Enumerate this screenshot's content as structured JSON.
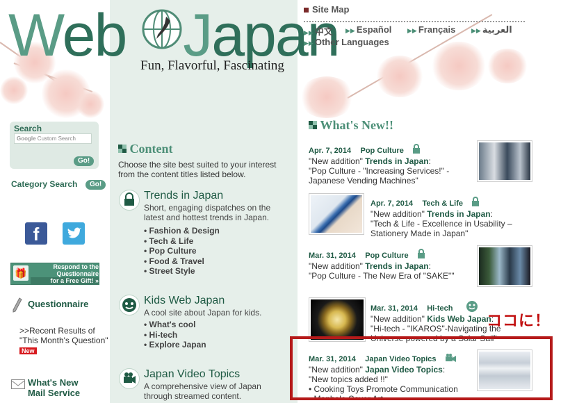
{
  "logo": {
    "first_letter": "W",
    "part1": "eb",
    "part2": "apan",
    "j": "J"
  },
  "tagline": "Fun, Flavorful, Fascinating",
  "search": {
    "label": "Search",
    "placeholder": "Custom Search",
    "google": "Google",
    "go": "Go!"
  },
  "category_search": {
    "label": "Category Search",
    "go": "Go!"
  },
  "social": {
    "facebook": "f"
  },
  "banner": {
    "line1": "Respond to the",
    "line2": "Questionnaire",
    "line3": "for a Free Gift! »"
  },
  "questionnaire": {
    "label": "Questionnaire",
    "recent": ">>Recent Results of \"This Month's Question\"",
    "new": "New"
  },
  "mail": {
    "line1": "What's New",
    "line2": "Mail Service"
  },
  "content": {
    "heading": "Content",
    "description": "Choose the site best suited to your interest from the content titles listed below.",
    "categories": [
      {
        "title": "Trends in Japan",
        "desc": "Short, engaging dispatches on the latest and hottest trends in Japan.",
        "items": [
          "Fashion & Design",
          "Tech & Life",
          "Pop Culture",
          "Food & Travel",
          "Street Style"
        ]
      },
      {
        "title": "Kids Web Japan",
        "desc": "A cool site about Japan for kids.",
        "items": [
          "What's cool",
          "Hi-tech",
          "Explore Japan"
        ]
      },
      {
        "title": "Japan Video Topics",
        "desc": "A comprehensive view of Japan through streamed content.",
        "items": []
      }
    ]
  },
  "header_links": {
    "sitemap": "Site Map",
    "languages": [
      "中文",
      "Español",
      "Français",
      "العربية"
    ],
    "other": "Other Languages"
  },
  "whats_new": {
    "heading": "What's New!!",
    "items": [
      {
        "date": "Apr. 7, 2014",
        "cat": "Pop Culture",
        "line1_pre": "\"New addition\" ",
        "line1_b": "Trends in Japan",
        "line1_post": ":",
        "line2": "\"Pop Culture - \"Increasing Services!\" -",
        "line3": "Japanese Vending Machines\""
      },
      {
        "date": "Apr. 7, 2014",
        "cat": "Tech & Life",
        "line1_pre": "\"New addition\" ",
        "line1_b": "Trends in Japan",
        "line1_post": ":",
        "line2": "\"Tech & Life - Excellence in Usability –",
        "line3": "Stationery Made in Japan\""
      },
      {
        "date": "Mar. 31, 2014",
        "cat": "Pop Culture",
        "line1_pre": "\"New addition\" ",
        "line1_b": "Trends in Japan",
        "line1_post": ":",
        "line2": "\"Pop Culture - The New Era of \"SAKE\"\"",
        "line3": ""
      },
      {
        "date": "Mar. 31, 2014",
        "cat": "Hi-tech",
        "line1_pre": "\"New addition\" ",
        "line1_b": "Kids Web Japan",
        "line1_post": ":",
        "line2": "\"Hi-tech - \"IKAROS\"-Navigating the",
        "line3": "Universe powered by a Solar Sail\""
      },
      {
        "date": "Mar. 31, 2014",
        "cat": "Japan Video Topics",
        "line1_pre": "\"New addition\" ",
        "line1_b": "Japan Video Topics",
        "line1_post": ":",
        "line2": "\"New topics added !!\"",
        "line3": "• Cooking Toys Promote Communication",
        "line4": "• Manhole Cover Art"
      }
    ]
  },
  "annotation": "ココに！",
  "colors": {
    "brand_green": "#2f6f5a",
    "accent_red": "#b51a1a",
    "center_bg": "#e6efea"
  }
}
